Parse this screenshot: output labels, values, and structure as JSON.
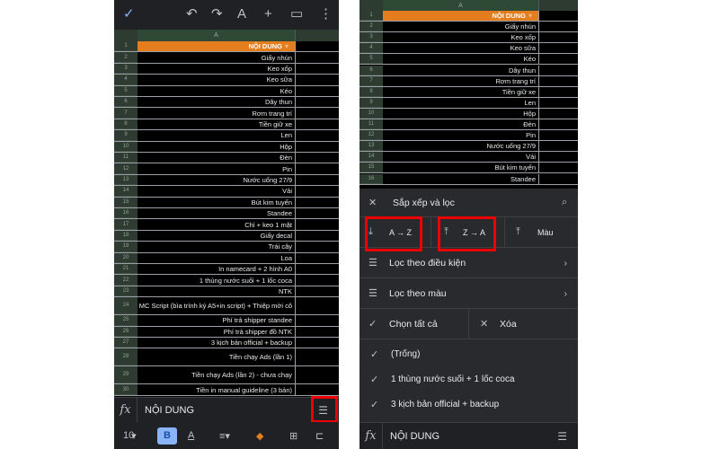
{
  "left": {
    "toolbar": {
      "check": "✓",
      "undo": "↶",
      "redo": "↷",
      "text_format": "A",
      "add": "+",
      "comment": "▭",
      "more": "⋮"
    },
    "column_header": "A",
    "rows": [
      "NỘI DUNG",
      "Giấy nhún",
      "Keo xốp",
      "Keo sữa",
      "Kéo",
      "Dây thun",
      "Rơm trang trí",
      "Tiền giữ xe",
      "Len",
      "Hộp",
      "Đèn",
      "Pin",
      "Nước uống 27/9",
      "Vải",
      "Bút kim tuyến",
      "Standee",
      "Chỉ + keo 1 mặt",
      "Giấy decal",
      "Trái cây",
      "Loa",
      "In namecard + 2 hình A0",
      "1 thùng nước suối + 1 lốc coca",
      "NTK",
      "MC Script (bìa trình ký A5+in script) + Thiệp mời cô",
      "Phí trả shipper standee",
      "Phí trả shipper đồ  NTK",
      "3 kịch bản official + backup",
      "Tiền chạy Ads (lần 1)",
      "Tiền chạy Ads (lần 2) - chưa chạy",
      "Tiền in manual guideline (3 bản)"
    ],
    "formula": {
      "fx": "fx",
      "value": "NỘI DUNG"
    },
    "format_bar": {
      "font_size": "10",
      "bold": "B",
      "text_color": "A"
    }
  },
  "right": {
    "column_header": "A",
    "rows": [
      "NỘI DUNG",
      "Giấy nhún",
      "Keo xốp",
      "Keo sữa",
      "Kéo",
      "Dây thun",
      "Rơm trang trí",
      "Tiền giữ xe",
      "Len",
      "Hộp",
      "Đèn",
      "Pin",
      "Nước uống 27/9",
      "Vải",
      "Bút kim tuyến",
      "Standee"
    ],
    "panel": {
      "title": "Sắp xếp và lọc",
      "sort_az": "A → Z",
      "sort_za": "Z → A",
      "sort_color": "Màu",
      "filter_condition": "Lọc theo điều kiện",
      "filter_color": "Lọc theo màu",
      "select_all": "Chọn tất cả",
      "clear": "Xóa",
      "values": [
        "(Trống)",
        "1 thùng nước suối + 1 lốc coca",
        "3 kịch bản official + backup"
      ]
    },
    "formula": {
      "fx": "fx",
      "value": "NỘI DUNG"
    }
  },
  "colors": {
    "header_orange": "#e37d1e",
    "highlight_red": "#e00000",
    "dark_bg": "#202124"
  }
}
